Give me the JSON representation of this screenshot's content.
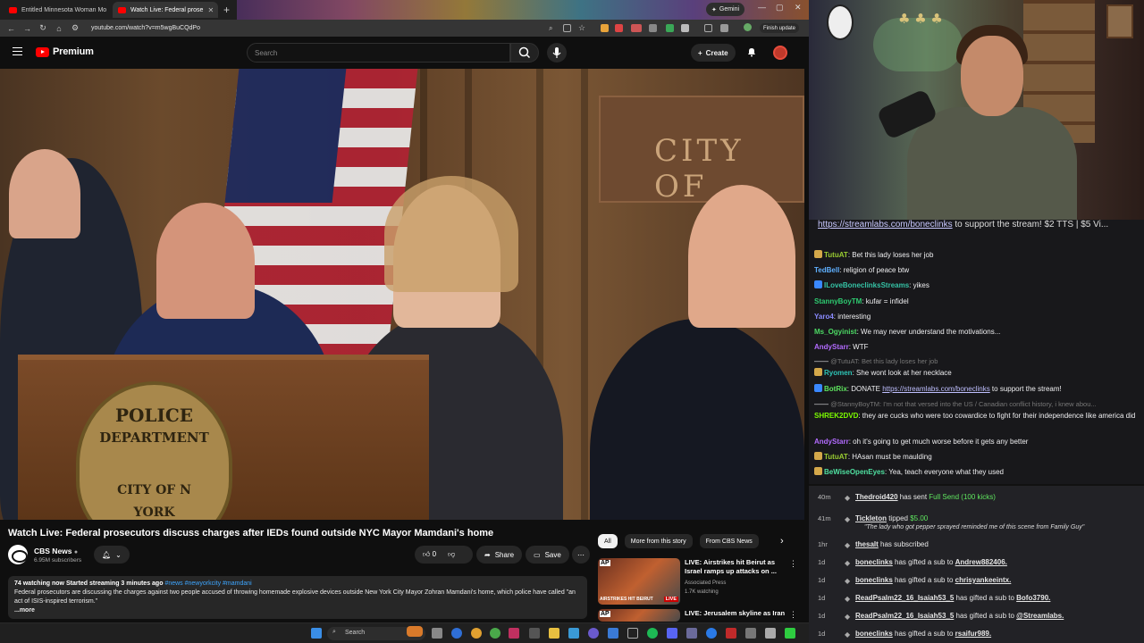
{
  "browser": {
    "tabs": [
      {
        "title": "Entitled Minnesota Woman Mo",
        "active": false
      },
      {
        "title": "Watch Live: Federal prose",
        "active": true
      }
    ],
    "gemini_label": "Gemini",
    "url": "youtube.com/watch?v=m5wgBuCQdPo",
    "finish_update_label": "Finish update"
  },
  "youtube": {
    "logo_text": "Premium",
    "search_placeholder": "Search",
    "create_label": "Create",
    "video": {
      "title": "Watch Live: Federal prosecutors discuss charges after IEDs found outside NYC Mayor Mamdani's home",
      "seal_lines": [
        "POLICE",
        "DEPARTMENT",
        "CITY OF N",
        "YORK"
      ],
      "sign_text": "CITY OF"
    },
    "channel": {
      "name": "CBS News",
      "subscribers": "6.95M subscribers"
    },
    "actions": {
      "like_count": "0",
      "share_label": "Share",
      "save_label": "Save"
    },
    "description": {
      "stats": "74 watching now  Started streaming 3 minutes ago",
      "tags": "#news #newyorkcity #mamdani",
      "text": "Federal prosecutors are discussing the charges against two people accused of throwing homemade explosive devices outside New York City Mayor Zohran Mamdani's home, which police have called \"an act of ISIS-inspired terrorism.\"",
      "more": "...more"
    },
    "chips": [
      "All",
      "More from this story",
      "From CBS News"
    ],
    "recommendations": [
      {
        "title": "LIVE: Airstrikes hit Beirut as Israel ramps up attacks on ...",
        "channel": "Associated Press",
        "meta": "1.7K watching",
        "thumb_caption": "AIRSTRIKES HIT BEIRUT",
        "live_badge": "LIVE"
      },
      {
        "title": "LIVE: Jerusalem skyline as Iran",
        "channel": "",
        "meta": "",
        "thumb_caption": "",
        "live_badge": ""
      }
    ]
  },
  "taskbar": {
    "search_label": "Search"
  },
  "stream": {
    "banner_link": "https://streamlabs.com/boneclinks",
    "banner_text": " to support the stream! $2 TTS | $5 Vi..."
  },
  "chat": [
    {
      "user": "TutuAT",
      "text": "Bet this lady loses her job",
      "color": "#9acd32",
      "badge": "#d4a84a"
    },
    {
      "user": "TedBell",
      "text": "religion of peace btw",
      "color": "#5fb0ff",
      "badge": ""
    },
    {
      "user": "ILoveBoneclinksStreams",
      "text": "yikes",
      "color": "#35c3a6",
      "badge": "#3a88ff"
    },
    {
      "user": "StannyBoyTM",
      "text": "kufar = infidel",
      "color": "#2ecc71",
      "badge": ""
    },
    {
      "user": "Yaro4",
      "text": "interesting",
      "color": "#8a8aff",
      "badge": ""
    },
    {
      "user": "Ms_Ogyinist",
      "text": "We may never understand the motivations...",
      "color": "#4cd964",
      "badge": ""
    },
    {
      "user": "AndyStarr",
      "text": "WTF",
      "color": "#b36bff",
      "badge": ""
    },
    {
      "reply": "@TutuAT: Bet this lady loses her job"
    },
    {
      "user": "Ryomen",
      "text": "She wont look at her necklace",
      "color": "#2ec4b6",
      "badge": "#d4a84a"
    },
    {
      "user": "BotRix",
      "text": "DONATE ",
      "link": "https://streamlabs.com/boneclinks",
      "after": " to support the stream!",
      "color": "#5fe65f",
      "badge": "#3a88ff"
    },
    {
      "reply": "@StannyBoyTM: I'm not that versed into the US / Canadian conflict history, i knew abou..."
    },
    {
      "user": "SHREK2DVD",
      "text": "they are cucks who were too cowardice to fight for their independence like america did",
      "color": "#7cfc00",
      "badge": ""
    },
    {
      "user": "AndyStarr",
      "text": "oh it's going to get much worse before it gets any better",
      "color": "#b36bff",
      "badge": ""
    },
    {
      "user": "TutuAT",
      "text": "HAsan must be maulding",
      "color": "#9acd32",
      "badge": "#d4a84a"
    },
    {
      "user": "BeWiseOpenEyes",
      "text": "Yea, teach everyone what they used",
      "color": "#4fe0a0",
      "badge": "#d4a84a"
    }
  ],
  "events": [
    {
      "time": "40m",
      "name": "Thedroid420",
      "text": " has sent ",
      "amount": "Full Send (100 kicks)",
      "quote": ""
    },
    {
      "time": "41m",
      "name": "Tickleton",
      "text": " tipped ",
      "amount": "$5.00",
      "quote": "\"The lady who got pepper sprayed reminded me of this scene from Family Guy\""
    },
    {
      "time": "1hr",
      "name": "thesalt",
      "text": " has subscribed",
      "amount": "",
      "quote": ""
    },
    {
      "time": "1d",
      "name": "boneclinks",
      "text": " has gifted a sub to ",
      "target": "Andrew882406.",
      "amount": "",
      "quote": ""
    },
    {
      "time": "1d",
      "name": "boneclinks",
      "text": " has gifted a sub to ",
      "target": "chrisyankeeintx.",
      "amount": "",
      "quote": ""
    },
    {
      "time": "1d",
      "name": "ReadPsalm22_16_Isaiah53_5",
      "text": " has gifted a sub to ",
      "target": "Bofo3790.",
      "amount": "",
      "quote": ""
    },
    {
      "time": "1d",
      "name": "ReadPsalm22_16_Isaiah53_5",
      "text": " has gifted a sub to ",
      "target": "@Streamlabs.",
      "amount": "",
      "quote": ""
    },
    {
      "time": "1d",
      "name": "boneclinks",
      "text": " has gifted a sub to ",
      "target": "rsaifur989.",
      "amount": "",
      "quote": ""
    }
  ]
}
